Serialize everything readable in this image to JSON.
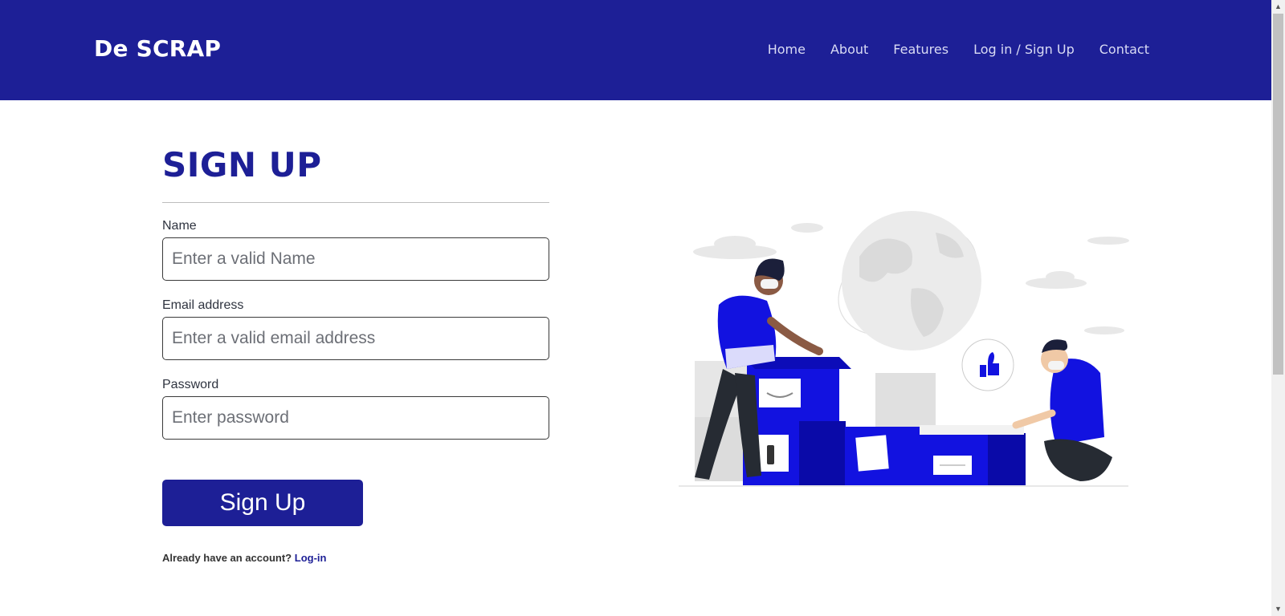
{
  "header": {
    "brand": "De SCRAP",
    "nav": [
      "Home",
      "About",
      "Features",
      "Log in / Sign Up",
      "Contact"
    ]
  },
  "form": {
    "title": "SIGN UP",
    "fields": [
      {
        "label": "Name",
        "placeholder": "Enter a valid Name"
      },
      {
        "label": "Email address",
        "placeholder": "Enter a valid email address"
      },
      {
        "label": "Password",
        "placeholder": "Enter password"
      }
    ],
    "submit_label": "Sign Up",
    "account_text": "Already have an account?",
    "login_link": "Log-in"
  },
  "colors": {
    "primary": "#1d1f96",
    "illustration_blue": "#1212e0"
  }
}
